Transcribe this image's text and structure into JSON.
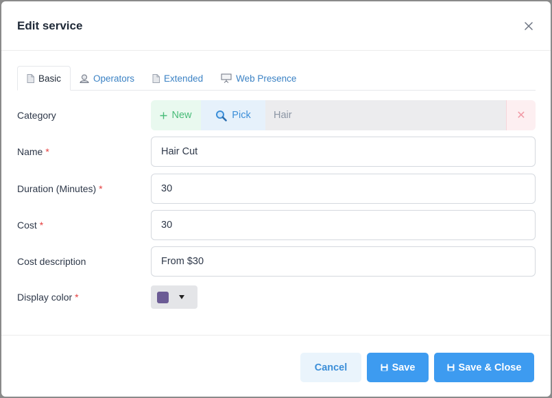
{
  "modal": {
    "title": "Edit service",
    "close_icon": "close-icon"
  },
  "tabs": [
    {
      "label": "Basic",
      "icon": "document-icon",
      "active": true
    },
    {
      "label": "Operators",
      "icon": "user-icon",
      "active": false
    },
    {
      "label": "Extended",
      "icon": "document-icon",
      "active": false
    },
    {
      "label": "Web Presence",
      "icon": "presentation-icon",
      "active": false
    }
  ],
  "form": {
    "category": {
      "label": "Category",
      "new_label": "New",
      "pick_label": "Pick",
      "value": "Hair",
      "clear_symbol": "✕"
    },
    "name": {
      "label": "Name",
      "required_mark": "*",
      "value": "Hair Cut"
    },
    "duration": {
      "label": "Duration (Minutes)",
      "required_mark": "*",
      "value": "30"
    },
    "cost": {
      "label": "Cost",
      "required_mark": "*",
      "value": "30"
    },
    "cost_description": {
      "label": "Cost description",
      "value": "From $30"
    },
    "display_color": {
      "label": "Display color",
      "required_mark": "*",
      "value": "#6b5b95"
    }
  },
  "footer": {
    "cancel_label": "Cancel",
    "save_label": "Save",
    "save_close_label": "Save & Close"
  },
  "colors": {
    "primary": "#3d9bf0",
    "required": "#e53e3e",
    "new_green": "#48bb78",
    "pick_blue": "#3b8ed8"
  }
}
